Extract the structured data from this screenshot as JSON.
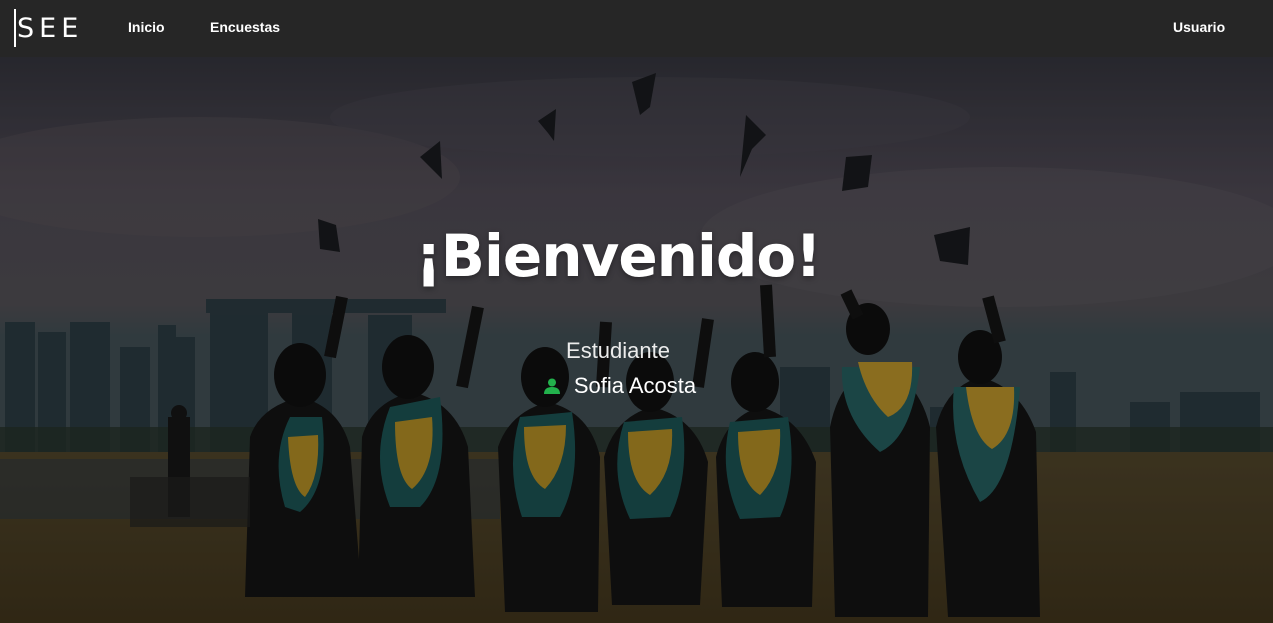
{
  "navbar": {
    "brand": "SEE",
    "links": [
      "Inicio",
      "Encuestas"
    ],
    "user_menu": "Usuario"
  },
  "hero": {
    "title": "¡Bienvenido!",
    "role": "Estudiante",
    "user_name": "Sofia Acosta",
    "user_icon": "person-icon",
    "user_icon_color": "#22b14c"
  }
}
